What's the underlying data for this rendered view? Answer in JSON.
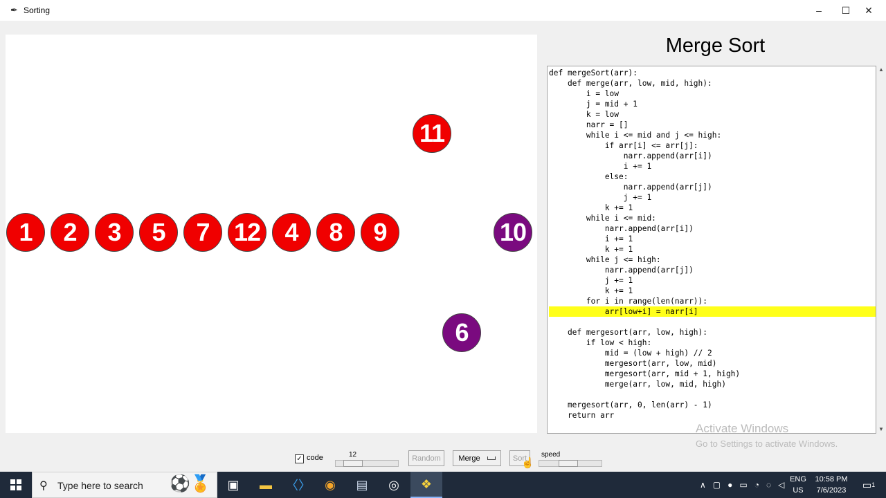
{
  "window": {
    "title": "Sorting",
    "controls": [
      "minimize",
      "maximize",
      "close"
    ]
  },
  "canvas": {
    "balls": [
      {
        "label": "1",
        "color": "#f00000"
      },
      {
        "label": "2",
        "color": "#f00000"
      },
      {
        "label": "3",
        "color": "#f00000"
      },
      {
        "label": "5",
        "color": "#f00000"
      },
      {
        "label": "7",
        "color": "#f00000"
      },
      {
        "label": "12",
        "color": "#f00000"
      },
      {
        "label": "4",
        "color": "#f00000"
      },
      {
        "label": "8",
        "color": "#f00000"
      },
      {
        "label": "9",
        "color": "#f00000"
      },
      {
        "label": "11",
        "color": "#f00000"
      },
      {
        "label": "10",
        "color": "#7a0a7f"
      },
      {
        "label": "6",
        "color": "#7a0a7f"
      }
    ]
  },
  "code_panel": {
    "title": "Merge Sort",
    "highlighted_line": 23,
    "lines": [
      "def mergeSort(arr):",
      "    def merge(arr, low, mid, high):",
      "        i = low",
      "        j = mid + 1",
      "        k = low",
      "        narr = []",
      "        while i <= mid and j <= high:",
      "            if arr[i] <= arr[j]:",
      "                narr.append(arr[i])",
      "                i += 1",
      "            else:",
      "                narr.append(arr[j])",
      "                j += 1",
      "            k += 1",
      "        while i <= mid:",
      "            narr.append(arr[i])",
      "            i += 1",
      "            k += 1",
      "        while j <= high:",
      "            narr.append(arr[j])",
      "            j += 1",
      "            k += 1",
      "        for i in range(len(narr)):",
      "            arr[low+i] = narr[i]",
      "",
      "    def mergesort(arr, low, high):",
      "        if low < high:",
      "            mid = (low + high) // 2",
      "            mergesort(arr, low, mid)",
      "            mergesort(arr, mid + 1, high)",
      "            merge(arr, low, mid, high)",
      "",
      "    mergesort(arr, 0, len(arr) - 1)",
      "    return arr"
    ],
    "highlight_color": "#ffff1a"
  },
  "watermark": {
    "line1": "Activate Windows",
    "line2": "Go to Settings to activate Windows."
  },
  "controls": {
    "code_checkbox_label": "code",
    "code_checked": true,
    "check_mark": "✓",
    "count_slider_value": "12",
    "random_label": "Random",
    "algorithm_selected": "Merge",
    "sort_label": "Sort",
    "speed_label": "speed"
  },
  "taskbar": {
    "search_placeholder": "Type here to search",
    "language": "ENG",
    "region": "US",
    "time": "10:58 PM",
    "date": "7/6/2023",
    "notification_count": "1",
    "background": "#1f2a3a"
  }
}
